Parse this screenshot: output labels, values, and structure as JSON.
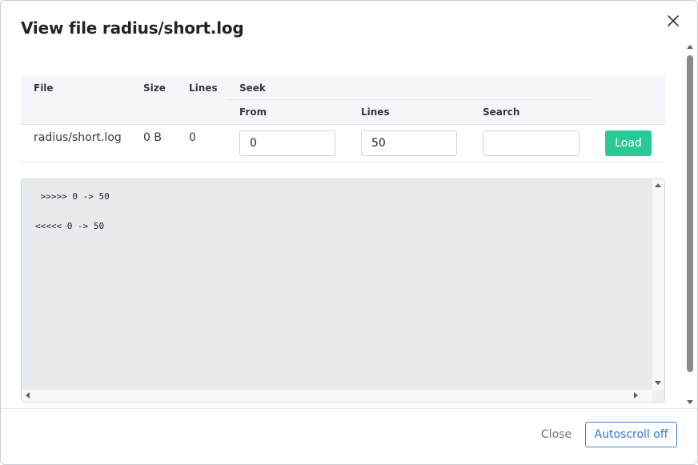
{
  "modal": {
    "title": "View file radius/short.log"
  },
  "table": {
    "headers": {
      "file": "File",
      "size": "Size",
      "lines": "Lines",
      "seek": "Seek",
      "from": "From",
      "seek_lines": "Lines",
      "search": "Search"
    },
    "row": {
      "file": "radius/short.log",
      "size": "0 B",
      "lines": "0",
      "from_value": "0",
      "lines_value": "50",
      "search_value": ""
    },
    "load_label": "Load"
  },
  "log": {
    "lines": [
      " >>>>> 0 -> 50",
      "<<<<< 0 -> 50"
    ]
  },
  "footer": {
    "close_label": "Close",
    "autoscroll_label": "Autoscroll off"
  },
  "colors": {
    "accent_green": "#2bc996",
    "accent_blue": "#3b82d6",
    "log_background": "#e8ebee"
  }
}
